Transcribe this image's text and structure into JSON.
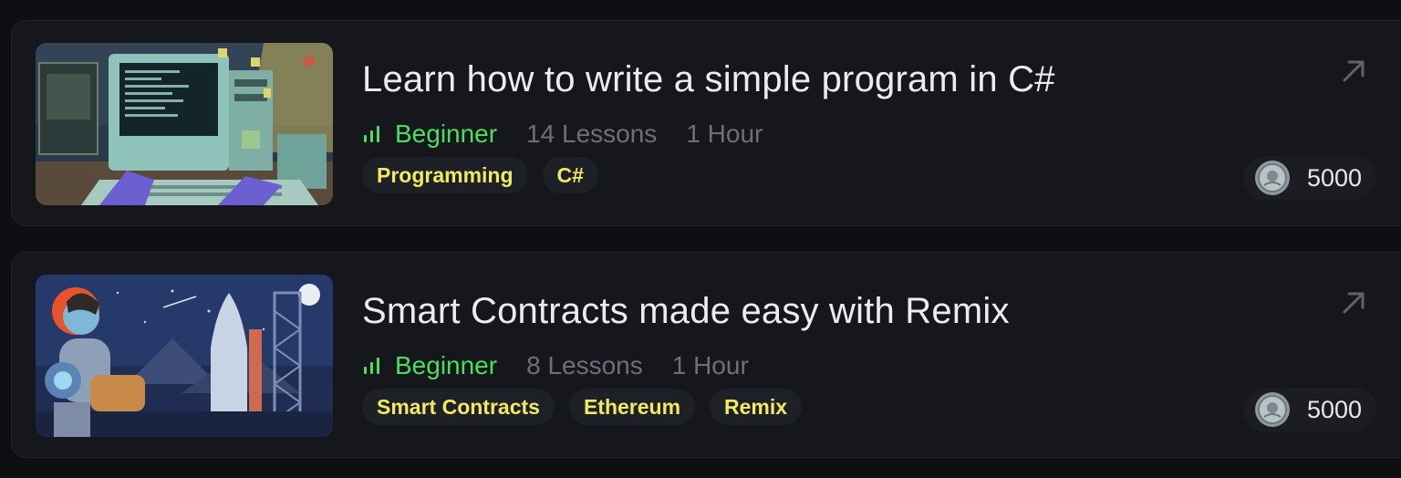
{
  "courses": [
    {
      "title": "Learn how to write a simple program in C#",
      "level": "Beginner",
      "lessons": "14 Lessons",
      "duration": "1 Hour",
      "tags": [
        "Programming",
        "C#"
      ],
      "reward": "5000",
      "thumbnail_icon": "retro-computer-illustration"
    },
    {
      "title": "Smart Contracts made easy with Remix",
      "level": "Beginner",
      "lessons": "8 Lessons",
      "duration": "1 Hour",
      "tags": [
        "Smart Contracts",
        "Ethereum",
        "Remix"
      ],
      "reward": "5000",
      "thumbnail_icon": "astronaut-rocket-illustration"
    }
  ],
  "colors": {
    "background": "#0e0f13",
    "card": "#15171d",
    "level_green": "#4ade5e",
    "tag_yellow": "#f2ea5e",
    "muted_text": "#6d7079"
  }
}
